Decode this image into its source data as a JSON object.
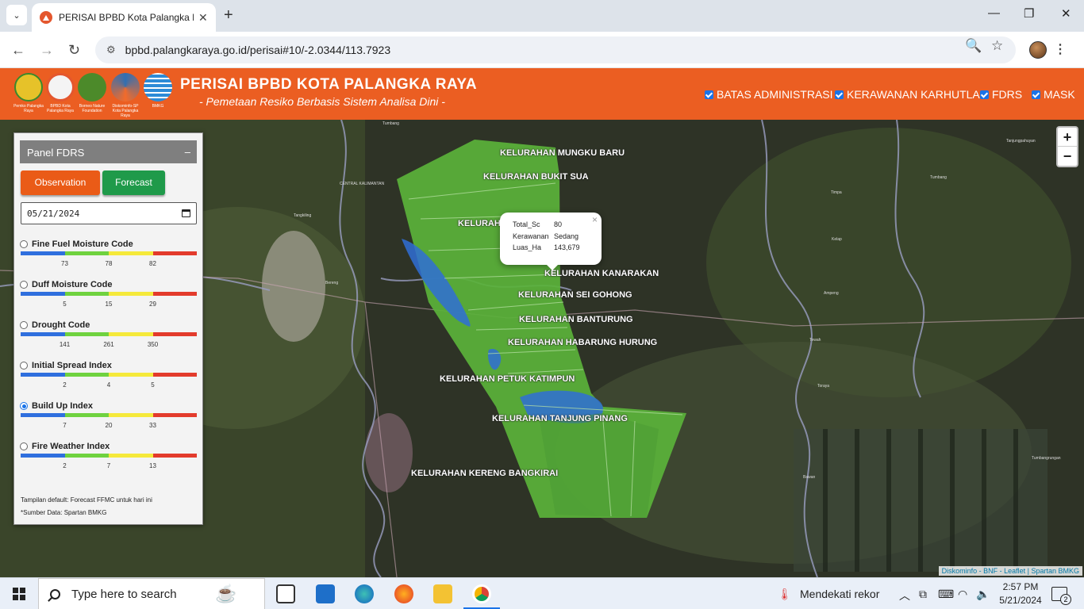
{
  "browser": {
    "tab_title": "PERISAI BPBD Kota Palangka Ra",
    "url": "bpbd.palangkaraya.go.id/perisai#10/-2.0344/113.7923"
  },
  "header": {
    "title": "PERISAI BPBD KOTA PALANGKA RAYA",
    "subtitle": "- Pemetaan Resiko Berbasis Sistem Analisa Dini -",
    "logos": [
      {
        "caption": "Pemko Palangka Raya",
        "color": "#e6c229"
      },
      {
        "caption": "BPBD Kota Palangka Raya",
        "color": "#f0a12b"
      },
      {
        "caption": "Borneo Nature Foundation",
        "color": "#4c8a2a"
      },
      {
        "caption": "Diskominfo-SP Kota Palangka Raya",
        "color": "#2f6fb3"
      },
      {
        "caption": "BMKG",
        "color": "#2d8bd6"
      }
    ],
    "layers": [
      "BATAS ADMINISTRASI",
      "KERAWANAN KARHUTLA",
      "FDRS",
      "MASK"
    ]
  },
  "map": {
    "zoom_in": "+",
    "zoom_out": "−",
    "attribution": "Diskominfo - BNF - Leaflet | Spartan BMKG",
    "kelurahan": [
      "KELURAHAN MUNGKU BARU",
      "KELURAHAN BUKIT SUA",
      "KELURAH",
      "KELURAHAN KANARAKAN",
      "KELURAHAN SEI GOHONG",
      "KELURAHAN BANTURUNG",
      "KELURAHAN HABARUNG HURUNG",
      "KELURAHAN PETUK KATIMPUN",
      "KELURAHAN TANJUNG PINANG",
      "KELURAHAN KERENG BANGKIRAI"
    ],
    "places": [
      "Tumbang",
      "CENTRAL KALIMANTAN",
      "Tangkiling",
      "Bereng",
      "Tanjungpahuyan",
      "Tumbang",
      "Timpa",
      "Ampeng",
      "Kelap",
      "Tewah",
      "Bawan",
      "Tumbangrungan",
      "Toraya"
    ],
    "popup": {
      "close": "×",
      "rows": [
        {
          "key": "Total_Sc",
          "value": "80"
        },
        {
          "key": "Kerawanan",
          "value": "Sedang"
        },
        {
          "key": "Luas_Ha",
          "value": "143,679"
        }
      ]
    }
  },
  "panel": {
    "title": "Panel FDRS",
    "minimize": "–",
    "observation_label": "Observation",
    "forecast_label": "Forecast",
    "date_value": "05/21/2024",
    "colors": [
      "#2f6fde",
      "#6fd23f",
      "#f5e93a",
      "#e33b2c"
    ],
    "indices": [
      {
        "name": "Fine Fuel Moisture Code",
        "ticks": [
          "73",
          "78",
          "82"
        ],
        "selected": false
      },
      {
        "name": "Duff Moisture Code",
        "ticks": [
          "5",
          "15",
          "29"
        ],
        "selected": false
      },
      {
        "name": "Drought Code",
        "ticks": [
          "141",
          "261",
          "350"
        ],
        "selected": false
      },
      {
        "name": "Initial Spread Index",
        "ticks": [
          "2",
          "4",
          "5"
        ],
        "selected": false
      },
      {
        "name": "Build Up Index",
        "ticks": [
          "7",
          "20",
          "33"
        ],
        "selected": true
      },
      {
        "name": "Fire Weather Index",
        "ticks": [
          "2",
          "7",
          "13"
        ],
        "selected": false
      }
    ],
    "note_default": "Tampilan default: Forecast FFMC untuk hari ini",
    "note_source": "*Sumber Data: Spartan BMKG"
  },
  "taskbar": {
    "search_placeholder": "Type here to search",
    "weather": "Mendekati rekor",
    "time": "2:57 PM",
    "date": "5/21/2024",
    "notifications": "2"
  }
}
